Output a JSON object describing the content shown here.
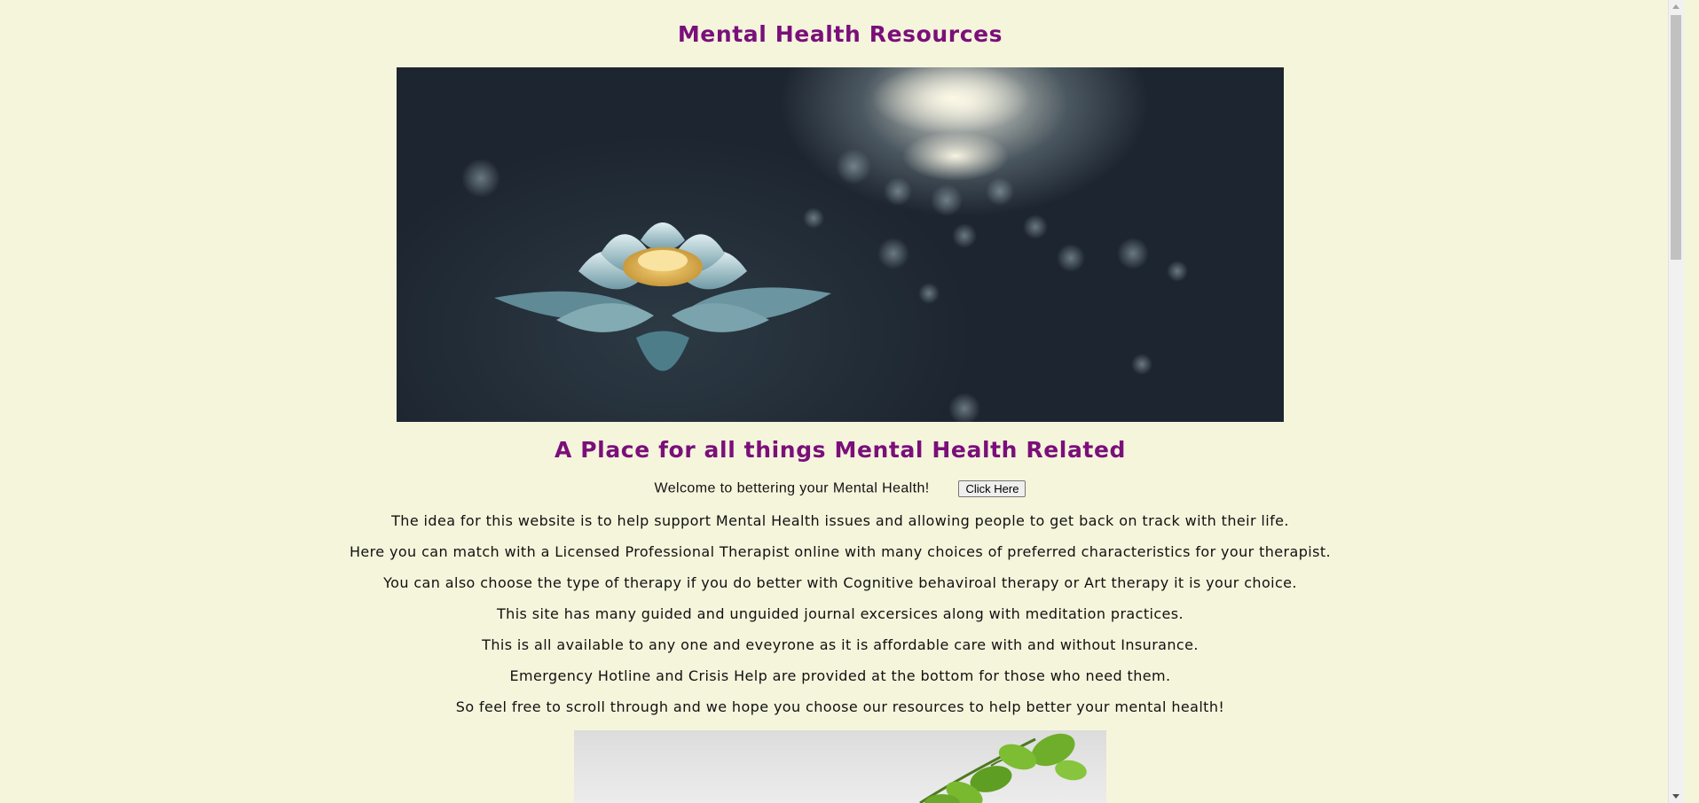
{
  "header": {
    "title": "Mental Health Resources"
  },
  "hero_image": {
    "subject": "lotus-flower-on-dark-water"
  },
  "main": {
    "tagline": "A Place for all things Mental Health Related",
    "welcome_text": "Welcome to bettering your Mental Health!",
    "click_button_label": "Click Here",
    "paragraphs": [
      "The idea for this website is to help support Mental Health issues and allowing people to get back on track with their life.",
      "Here you can match with a Licensed Professional Therapist online with many choices of preferred characteristics for your therapist.",
      "You can also choose the type of therapy if you do better with Cognitive behaviroal therapy or Art therapy it is your choice.",
      "This site has many guided and unguided journal excersices along with meditation practices.",
      "This is all available to any one and eveyrone as it is affordable care with and without Insurance.",
      "Emergency Hotline and Crisis Help are provided at the bottom for those who need them.",
      "So feel free to scroll through and we hope you choose our resources to help better your mental health!"
    ]
  },
  "secondary_image": {
    "subject": "green-leaf-branch-on-white"
  },
  "colors": {
    "background": "#f5f5dc",
    "heading": "#7a0f7a",
    "text": "#111111"
  }
}
